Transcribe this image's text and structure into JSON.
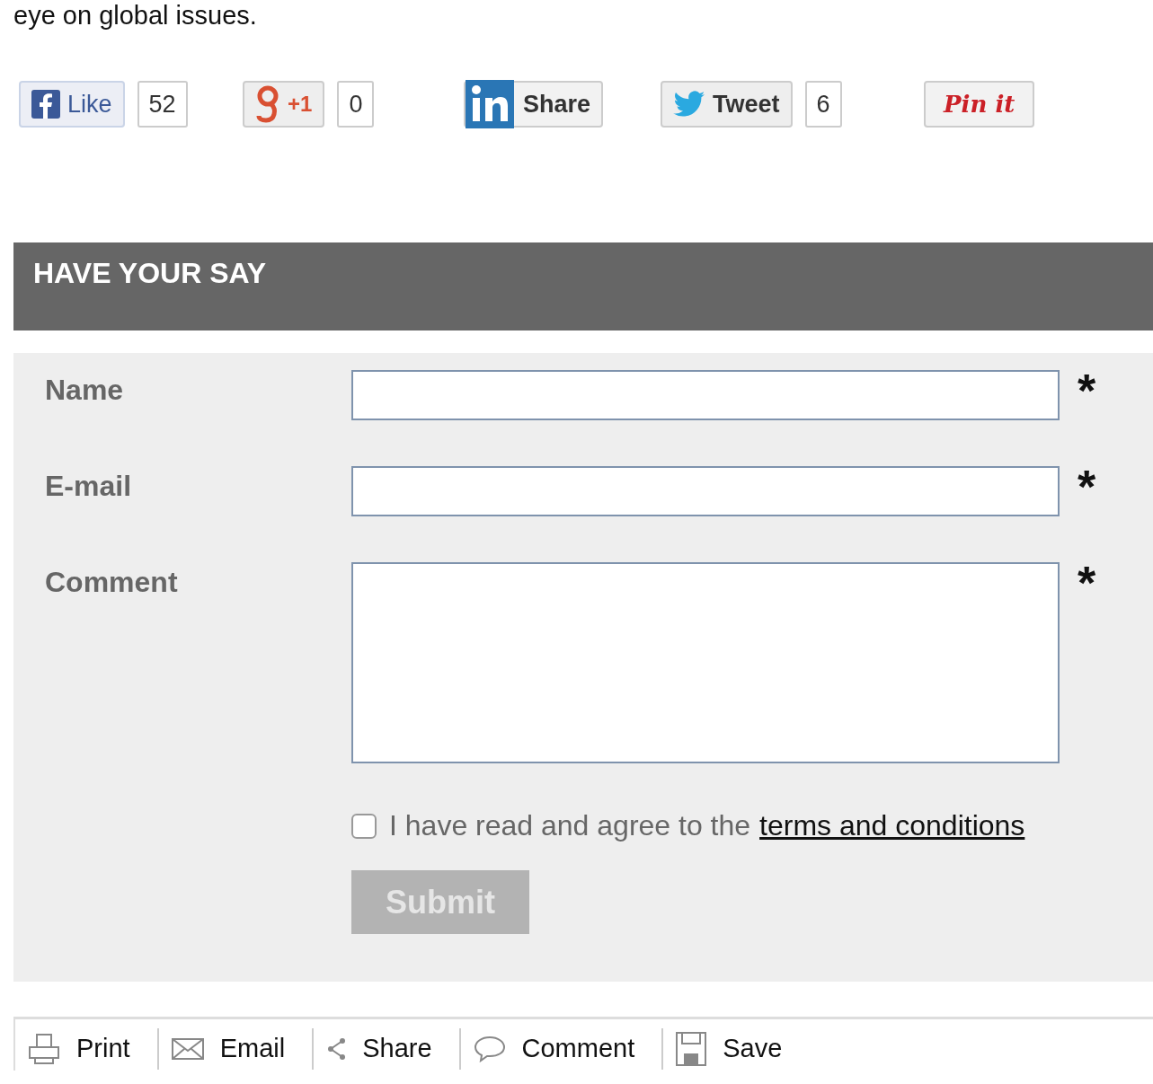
{
  "intro_text": "eye on global issues.",
  "social": [
    {
      "kind": "facebook",
      "label": "Like",
      "count": "52"
    },
    {
      "kind": "google",
      "label": "+1",
      "count": "0"
    },
    {
      "kind": "linkedin",
      "label": "Share"
    },
    {
      "kind": "twitter",
      "label": "Tweet",
      "count": "6"
    },
    {
      "kind": "pinterest",
      "label": "Pin it"
    }
  ],
  "form": {
    "title": "HAVE YOUR SAY",
    "fields": [
      {
        "label": "Name",
        "kind": "text",
        "marker": "*"
      },
      {
        "label": "E-mail",
        "kind": "text",
        "marker": "*"
      },
      {
        "label": "Comment",
        "kind": "textarea",
        "marker": "*"
      }
    ],
    "agree": {
      "text": "I have read and agree to the",
      "link": "terms and conditions",
      "checked": false
    },
    "submit": {
      "label": "Submit",
      "disabled": true
    }
  },
  "toolbar": [
    {
      "kind": "print",
      "label": "Print"
    },
    {
      "kind": "email",
      "label": "Email"
    },
    {
      "kind": "share",
      "label": "Share"
    },
    {
      "kind": "comment",
      "label": "Comment"
    },
    {
      "kind": "save",
      "label": "Save"
    }
  ]
}
